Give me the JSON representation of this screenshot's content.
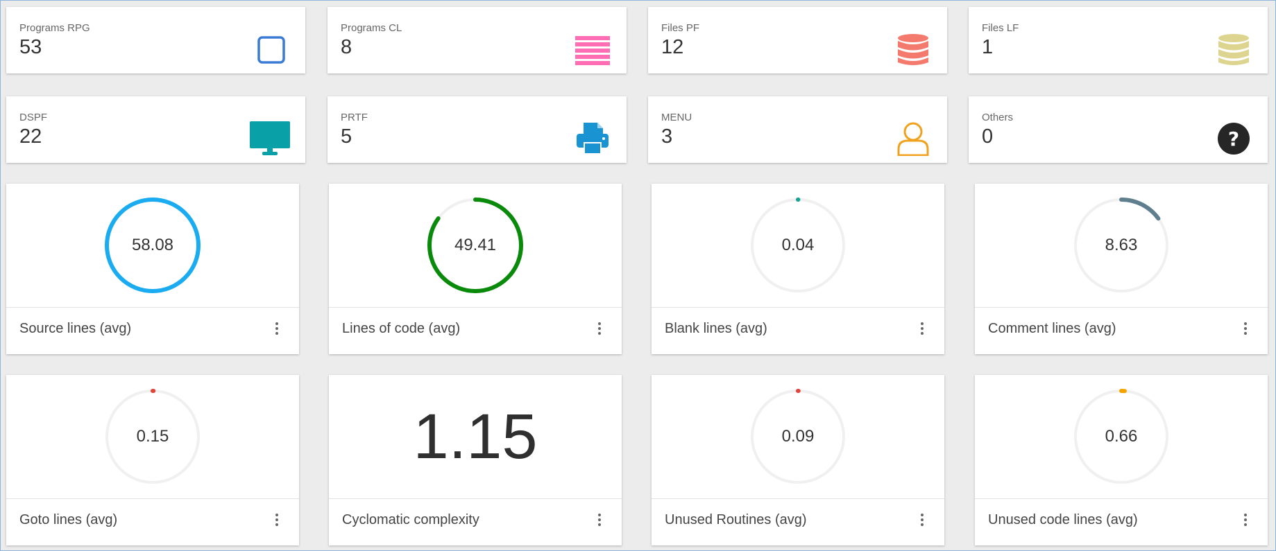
{
  "stats": [
    {
      "label": "Programs RPG",
      "value": "53",
      "icon": "square-outline-icon",
      "color": "#3a7bd5"
    },
    {
      "label": "Programs CL",
      "value": "8",
      "icon": "bars-icon",
      "color": "#ff6eb4"
    },
    {
      "label": "Files PF",
      "value": "12",
      "icon": "database-icon",
      "color": "#f47a6e"
    },
    {
      "label": "Files LF",
      "value": "1",
      "icon": "database-icon",
      "color": "#ddd58f"
    },
    {
      "label": "DSPF",
      "value": "22",
      "icon": "monitor-icon",
      "color": "#0aa0a8"
    },
    {
      "label": "PRTF",
      "value": "5",
      "icon": "printer-icon",
      "color": "#1a93d3"
    },
    {
      "label": "MENU",
      "value": "3",
      "icon": "user-outline-icon",
      "color": "#f0a21f"
    },
    {
      "label": "Others",
      "value": "0",
      "icon": "question-circle-icon",
      "color": "#262626"
    }
  ],
  "metrics": [
    {
      "title": "Source lines (avg)",
      "value": "58.08",
      "progress": 1.0,
      "color": "#1aabf0"
    },
    {
      "title": "Lines of code (avg)",
      "value": "49.41",
      "progress": 0.85,
      "color": "#0a8a0a"
    },
    {
      "title": "Blank lines (avg)",
      "value": "0.04",
      "progress": 0.001,
      "color": "#16a394"
    },
    {
      "title": "Comment lines (avg)",
      "value": "8.63",
      "progress": 0.15,
      "color": "#5f7e8e"
    },
    {
      "title": "Goto lines (avg)",
      "value": "0.15",
      "progress": 0.003,
      "color": "#e0463a"
    },
    {
      "title": "Cyclomatic complexity",
      "value": "1.15",
      "progress": null,
      "color": "#2f2f2f"
    },
    {
      "title": "Unused Routines (avg)",
      "value": "0.09",
      "progress": 0.002,
      "color": "#e0463a"
    },
    {
      "title": "Unused code lines (avg)",
      "value": "0.66",
      "progress": 0.012,
      "color": "#f5a300"
    }
  ]
}
